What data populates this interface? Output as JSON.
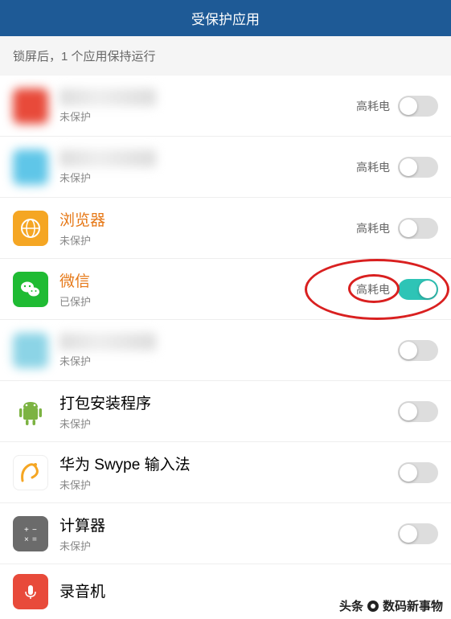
{
  "header": {
    "title": "受保护应用"
  },
  "subtitle": "锁屏后，1 个应用保持运行",
  "status_protected": "已保护",
  "status_unprotected": "未保护",
  "badge_high_power": "高耗电",
  "watermark": {
    "prefix": "头条",
    "text": "数码新事物"
  },
  "apps": [
    {
      "name": "",
      "status": "未保护",
      "badge": "高耗电",
      "on": false,
      "blurred": true,
      "icon_bg": "#e84a3a"
    },
    {
      "name": "",
      "status": "未保护",
      "badge": "高耗电",
      "on": false,
      "blurred": true,
      "icon_bg": "#5fc6e8"
    },
    {
      "name": "浏览器",
      "status": "未保护",
      "badge": "高耗电",
      "on": false,
      "orange": true,
      "icon": "browser"
    },
    {
      "name": "微信",
      "status": "已保护",
      "badge": "高耗电",
      "on": true,
      "orange": true,
      "icon": "wechat",
      "highlighted": true
    },
    {
      "name": "",
      "status": "未保护",
      "badge": "",
      "on": false,
      "blurred": true,
      "icon_bg": "#8cd4e6"
    },
    {
      "name": "打包安装程序",
      "status": "未保护",
      "badge": "",
      "on": false,
      "icon": "android"
    },
    {
      "name": "华为 Swype 输入法",
      "status": "未保护",
      "badge": "",
      "on": false,
      "icon": "swype"
    },
    {
      "name": "计算器",
      "status": "未保护",
      "badge": "",
      "on": false,
      "icon": "calc"
    },
    {
      "name": "录音机",
      "status": "",
      "badge": "",
      "on": false,
      "icon": "recorder",
      "partial": true
    }
  ]
}
